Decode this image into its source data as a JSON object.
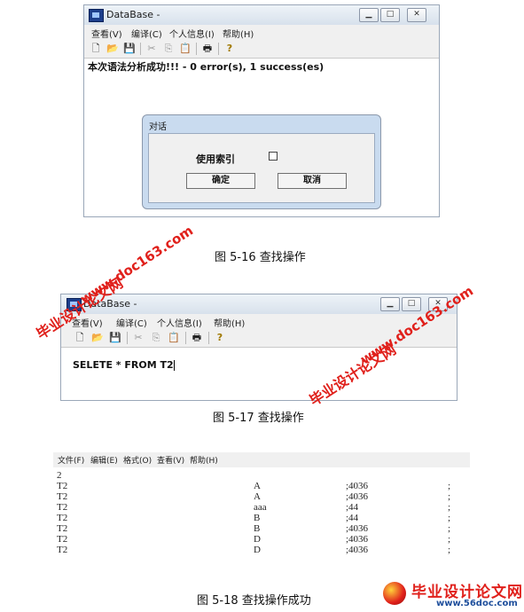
{
  "window1": {
    "title": "DataBase -",
    "menu": [
      "查看(V)",
      "编译(C)",
      "个人信息(I)",
      "帮助(H)"
    ],
    "status_message": "本次语法分析成功!!! - 0 error(s), 1 success(es)",
    "dialog": {
      "title": "对话",
      "checkbox_label": "使用索引",
      "ok_label": "确定",
      "cancel_label": "取消"
    }
  },
  "caption1": "图 5-16 查找操作",
  "window2": {
    "title": "DataBase -",
    "menu": [
      "查看(V)",
      "编译(C)",
      "个人信息(I)",
      "帮助(H)"
    ],
    "editor_text": "SELETE * FROM T2"
  },
  "caption2": "图 5-17 查找操作",
  "window3": {
    "menu": [
      "文件(F)",
      "编辑(E)",
      "格式(O)",
      "查看(V)",
      "帮助(H)"
    ],
    "first_line": "2",
    "rows": [
      [
        "T2",
        "A",
        ";4036",
        ";"
      ],
      [
        "T2",
        "A",
        ";4036",
        ";"
      ],
      [
        "T2",
        "aaa",
        ";44",
        ";"
      ],
      [
        "T2",
        "B",
        ";44",
        ";"
      ],
      [
        "T2",
        "B",
        ";4036",
        ";"
      ],
      [
        "T2",
        "D",
        ";4036",
        ";"
      ],
      [
        "T2",
        "D",
        ";4036",
        ";"
      ]
    ]
  },
  "caption3": "图 5-18 查找操作成功",
  "watermarks": {
    "site_url_1": "www.doc163.com",
    "site_name_1": "毕业设计论文网",
    "site_url_2": "www.doc163.com",
    "site_name_2": "毕业设计论文网",
    "logo_name": "毕业设计论文网",
    "logo_url": "www.56doc.com"
  },
  "colors": {
    "watermark_red": "#e0201b",
    "titlebar_blue": "#d7e1ec",
    "dialog_frame": "#c9dbef"
  }
}
